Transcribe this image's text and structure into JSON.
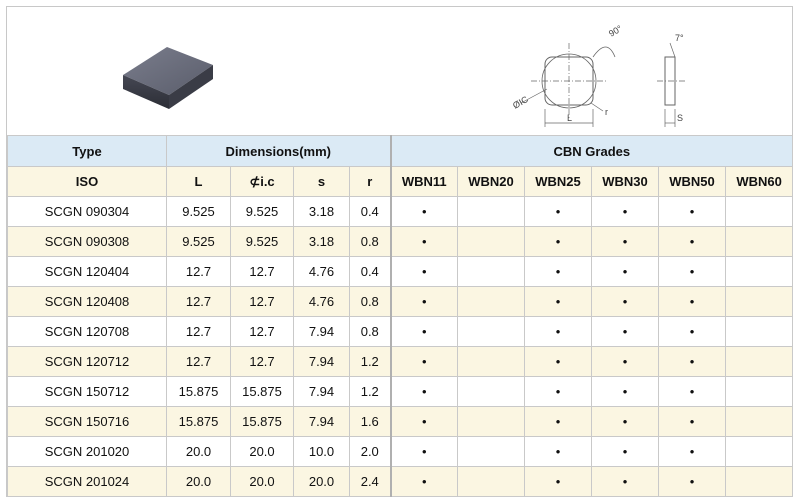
{
  "header_row_1": {
    "type": "Type",
    "dimensions": "Dimensions(mm)",
    "grades": "CBN Grades"
  },
  "header_row_2": {
    "iso": "ISO",
    "l": "L",
    "ic": "⊄i.c",
    "s": "s",
    "r": "r",
    "grades": [
      "WBN11",
      "WBN20",
      "WBN25",
      "WBN30",
      "WBN50",
      "WBN60"
    ]
  },
  "drawing_labels": {
    "angle_90": "90°",
    "angle_7": "7°",
    "ic": "ØIC",
    "r": "r",
    "l": "L",
    "s": "S"
  },
  "dot_symbol": "•",
  "rows": [
    {
      "iso": "SCGN 090304",
      "l": "9.525",
      "ic": "9.525",
      "s": "3.18",
      "r": "0.4",
      "grades": [
        true,
        false,
        true,
        true,
        true,
        false
      ]
    },
    {
      "iso": "SCGN 090308",
      "l": "9.525",
      "ic": "9.525",
      "s": "3.18",
      "r": "0.8",
      "grades": [
        true,
        false,
        true,
        true,
        true,
        false
      ]
    },
    {
      "iso": "SCGN 120404",
      "l": "12.7",
      "ic": "12.7",
      "s": "4.76",
      "r": "0.4",
      "grades": [
        true,
        false,
        true,
        true,
        true,
        false
      ]
    },
    {
      "iso": "SCGN 120408",
      "l": "12.7",
      "ic": "12.7",
      "s": "4.76",
      "r": "0.8",
      "grades": [
        true,
        false,
        true,
        true,
        true,
        false
      ]
    },
    {
      "iso": "SCGN 120708",
      "l": "12.7",
      "ic": "12.7",
      "s": "7.94",
      "r": "0.8",
      "grades": [
        true,
        false,
        true,
        true,
        true,
        false
      ]
    },
    {
      "iso": "SCGN 120712",
      "l": "12.7",
      "ic": "12.7",
      "s": "7.94",
      "r": "1.2",
      "grades": [
        true,
        false,
        true,
        true,
        true,
        false
      ]
    },
    {
      "iso": "SCGN 150712",
      "l": "15.875",
      "ic": "15.875",
      "s": "7.94",
      "r": "1.2",
      "grades": [
        true,
        false,
        true,
        true,
        true,
        false
      ]
    },
    {
      "iso": "SCGN 150716",
      "l": "15.875",
      "ic": "15.875",
      "s": "7.94",
      "r": "1.6",
      "grades": [
        true,
        false,
        true,
        true,
        true,
        false
      ]
    },
    {
      "iso": "SCGN 201020",
      "l": "20.0",
      "ic": "20.0",
      "s": "10.0",
      "r": "2.0",
      "grades": [
        true,
        false,
        true,
        true,
        true,
        false
      ]
    },
    {
      "iso": "SCGN 201024",
      "l": "20.0",
      "ic": "20.0",
      "s": "20.0",
      "r": "2.4",
      "grades": [
        true,
        false,
        true,
        true,
        true,
        false
      ]
    }
  ]
}
